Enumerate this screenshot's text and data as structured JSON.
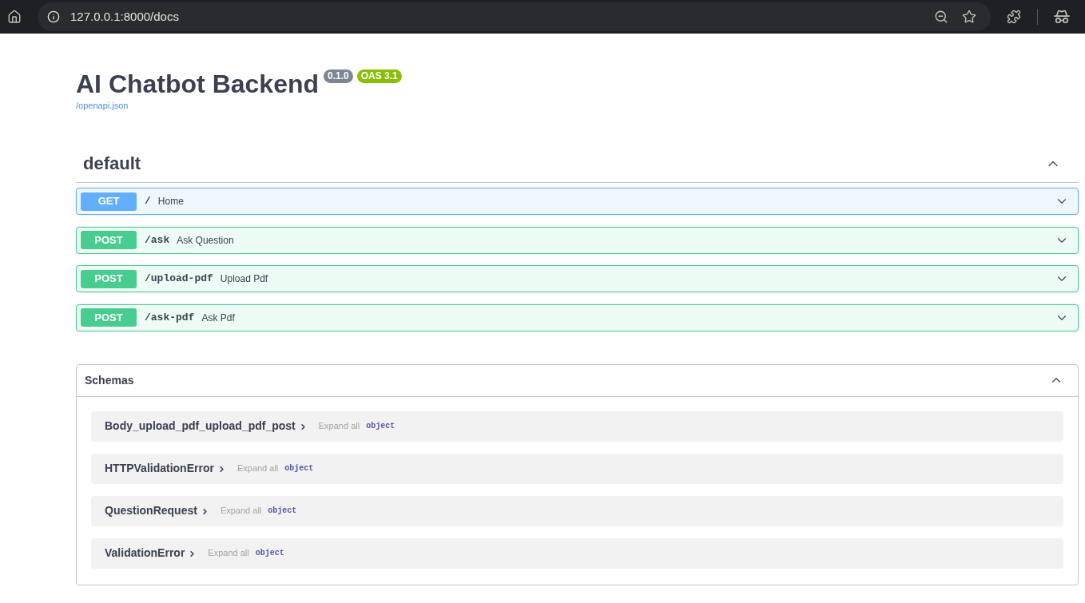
{
  "browser": {
    "url": "127.0.0.1:8000/docs"
  },
  "info": {
    "title": "AI Chatbot Backend",
    "badges": [
      {
        "text": "0.1.0",
        "kind": "version"
      },
      {
        "text": "OAS 3.1",
        "kind": "oas"
      }
    ],
    "spec_link": "/openapi.json"
  },
  "tag": {
    "name": "default",
    "expanded": true,
    "operations": [
      {
        "kind": "get",
        "method": "GET",
        "path": "/",
        "summary": "Home",
        "expanded": false
      },
      {
        "kind": "post",
        "method": "POST",
        "path": "/ask",
        "summary": "Ask Question",
        "expanded": false
      },
      {
        "kind": "post",
        "method": "POST",
        "path": "/upload-pdf",
        "summary": "Upload Pdf",
        "expanded": false
      },
      {
        "kind": "post",
        "method": "POST",
        "path": "/ask-pdf",
        "summary": "Ask Pdf",
        "expanded": false
      }
    ]
  },
  "schemas": {
    "title": "Schemas",
    "expanded": true,
    "models": [
      {
        "name": "Body_upload_pdf_upload_pdf_post",
        "expand_all": "Expand all",
        "type": "object",
        "expanded": false
      },
      {
        "name": "HTTPValidationError",
        "expand_all": "Expand all",
        "type": "object",
        "expanded": false
      },
      {
        "name": "QuestionRequest",
        "expand_all": "Expand all",
        "type": "object",
        "expanded": false
      },
      {
        "name": "ValidationError",
        "expand_all": "Expand all",
        "type": "object",
        "expanded": false
      }
    ]
  }
}
